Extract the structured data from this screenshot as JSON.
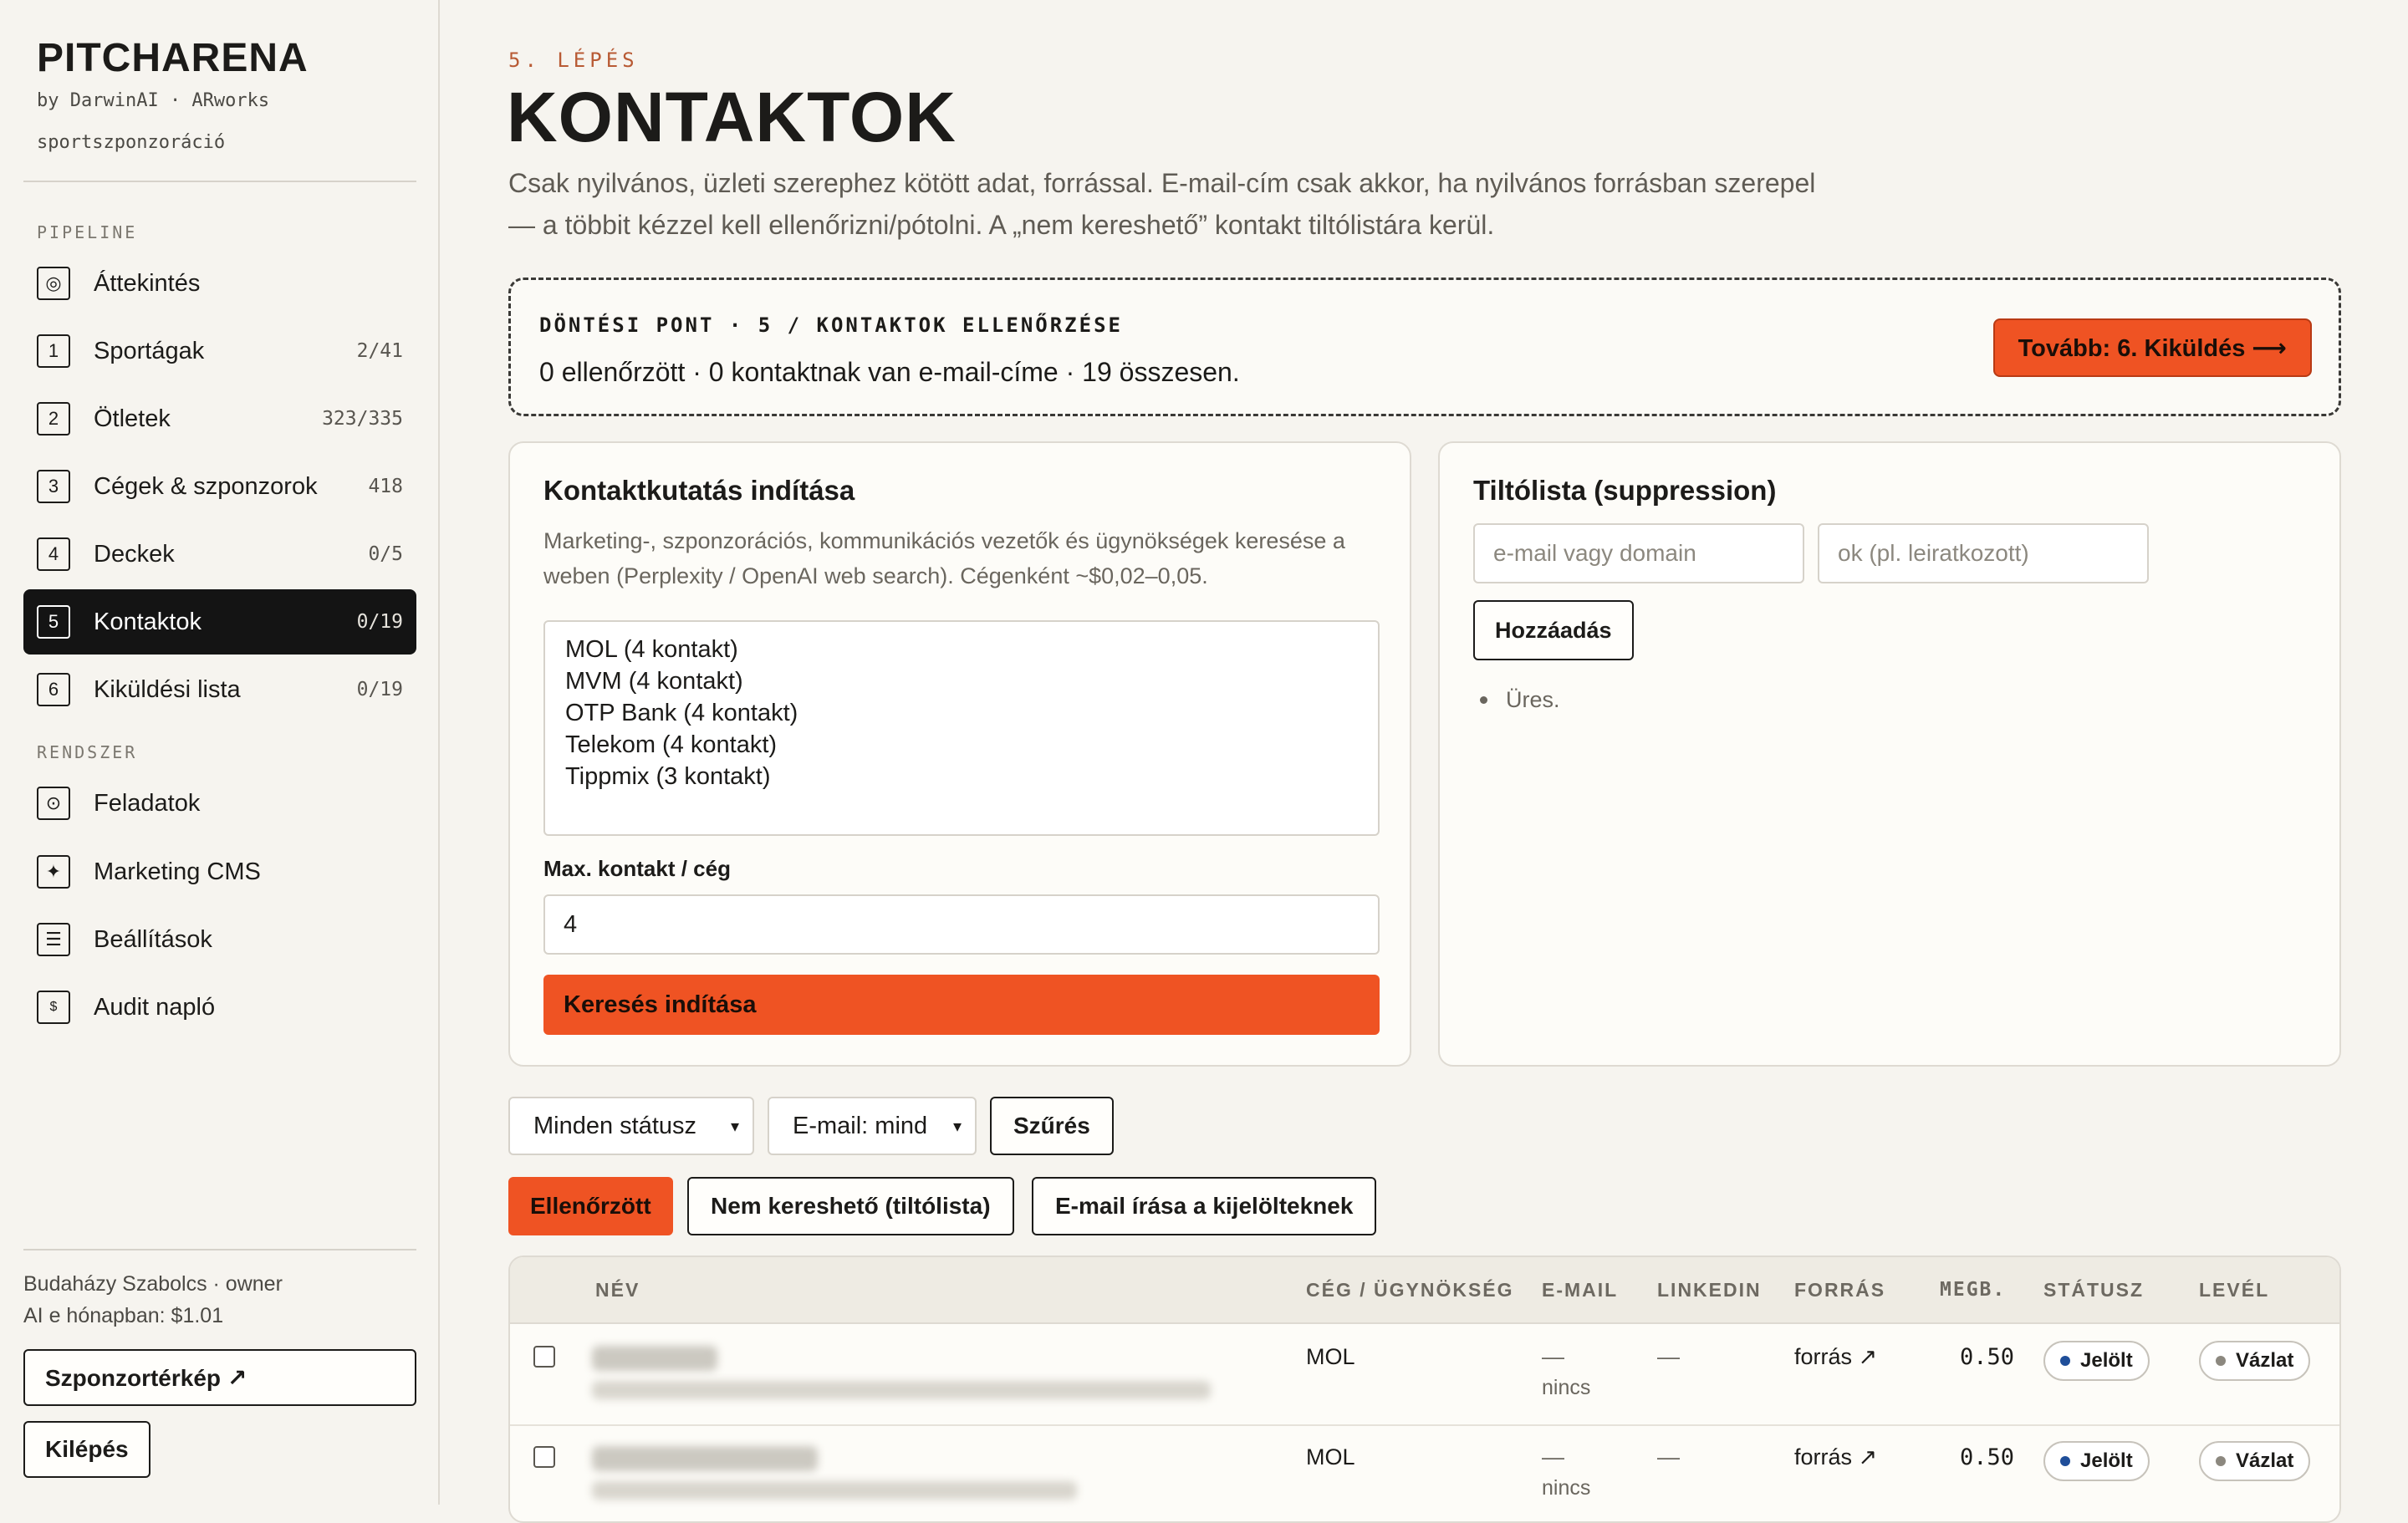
{
  "brand": {
    "title": "PITCHARENA",
    "subtitle": "by DarwinAI · ARworks",
    "tagline": "sportszponzoráció"
  },
  "nav": {
    "section_pipeline": "PIPELINE",
    "section_system": "RENDSZER",
    "pipeline_items": [
      {
        "icon": "◎",
        "icon_name": "overview-icon",
        "label": "Áttekintés",
        "count": ""
      },
      {
        "icon": "1",
        "icon_name": "step-1-icon",
        "label": "Sportágak",
        "count": "2/41"
      },
      {
        "icon": "2",
        "icon_name": "step-2-icon",
        "label": "Ötletek",
        "count": "323/335"
      },
      {
        "icon": "3",
        "icon_name": "step-3-icon",
        "label": "Cégek & szponzorok",
        "count": "418"
      },
      {
        "icon": "4",
        "icon_name": "step-4-icon",
        "label": "Deckek",
        "count": "0/5"
      },
      {
        "icon": "5",
        "icon_name": "step-5-icon",
        "label": "Kontaktok",
        "count": "0/19"
      },
      {
        "icon": "6",
        "icon_name": "step-6-icon",
        "label": "Kiküldési lista",
        "count": "0/19"
      }
    ],
    "system_items": [
      {
        "icon": "⊙",
        "icon_name": "tasks-icon",
        "label": "Feladatok"
      },
      {
        "icon": "✦",
        "icon_name": "sparkle-icon",
        "label": "Marketing CMS"
      },
      {
        "icon": "☰",
        "icon_name": "settings-icon",
        "label": "Beállítások"
      },
      {
        "icon": "$",
        "icon_name": "audit-icon",
        "label": "Audit napló"
      }
    ],
    "active_index": 5
  },
  "user": {
    "line": "Budaházy Szabolcs · owner",
    "ai_cost": "AI e hónapban: $1.01",
    "map_button": "Szponzortérkép ↗",
    "logout_button": "Kilépés"
  },
  "page": {
    "step": "5. LÉPÉS",
    "title": "KONTAKTOK",
    "description": "Csak nyilvános, üzleti szerephez kötött adat, forrással. E-mail-cím csak akkor, ha nyilvános forrásban szerepel — a többit kézzel kell ellenőrizni/pótolni. A „nem kereshető” kontakt tiltólistára kerül."
  },
  "decision": {
    "title": "DÖNTÉSI PONT · 5 / KONTAKTOK ELLENŐRZÉSE",
    "status": "0 ellenőrzött · 0 kontaktnak van e-mail-címe · 19 összesen.",
    "next_button": "Tovább: 6. Kiküldés ⟶"
  },
  "research": {
    "title": "Kontaktkutatás indítása",
    "description": "Marketing-, szponzorációs, kommunikációs vezetők és ügynökségek keresése a weben (Perplexity / OpenAI web search). Cégenként ~$0,02–0,05.",
    "companies": [
      "MOL (4 kontakt)",
      "MVM (4 kontakt)",
      "OTP Bank (4 kontakt)",
      "Telekom (4 kontakt)",
      "Tippmix (3 kontakt)"
    ],
    "max_label": "Max. kontakt / cég",
    "max_value": "4",
    "search_button": "Keresés indítása"
  },
  "suppression": {
    "title": "Tiltólista (suppression)",
    "email_placeholder": "e-mail vagy domain",
    "reason_placeholder": "ok (pl. leiratkozott)",
    "add_button": "Hozzáadás",
    "empty_text": "Üres."
  },
  "filters": {
    "status_select": "Minden státusz",
    "email_select": "E-mail: mind",
    "filter_button": "Szűrés",
    "verified_button": "Ellenőrzött",
    "not_searchable_button": "Nem kereshető (tiltólista)",
    "write_email_button": "E-mail írása a kijelölteknek"
  },
  "table": {
    "headers": {
      "name": "NÉV",
      "company": "CÉG / ÜGYNÖKSÉG",
      "email": "E-MAIL",
      "linkedin": "LINKEDIN",
      "source": "FORRÁS",
      "confidence": "MEGB.",
      "status": "STÁTUSZ",
      "letter": "LEVÉL"
    },
    "rows": [
      {
        "company": "MOL",
        "email_dash": "—",
        "email_note": "nincs",
        "linkedin": "—",
        "source": "forrás ↗",
        "confidence": "0.50",
        "status": "Jelölt",
        "letter": "Vázlat"
      },
      {
        "company": "MOL",
        "email_dash": "—",
        "email_note": "nincs",
        "linkedin": "—",
        "source": "forrás ↗",
        "confidence": "0.50",
        "status": "Jelölt",
        "letter": "Vázlat"
      }
    ]
  },
  "colors": {
    "accent": "#ef5323",
    "active_nav": "#141414",
    "status_dot": "#1f4e99",
    "draft_dot": "#8c887f"
  }
}
